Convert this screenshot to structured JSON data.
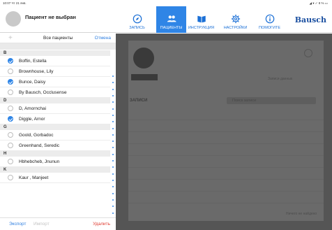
{
  "status_bar": {
    "time": "10:07  Чт 21 янв.",
    "system": "◢ ▾ ✓ 8 % ▭"
  },
  "header": {
    "patient_title": "Пациент не выбран",
    "brand": "Bausch",
    "nav": [
      {
        "label": "ЗАПИСЬ",
        "icon": "compass-icon",
        "active": false
      },
      {
        "label": "ПАЦИЕНТЫ",
        "icon": "people-icon",
        "active": true
      },
      {
        "label": "ИНСТРУКЦИЯ",
        "icon": "book-icon",
        "active": false
      },
      {
        "label": "НАСТРОЙКИ",
        "icon": "gear-icon",
        "active": false
      },
      {
        "label": "ПОМОГИТЕ",
        "icon": "info-icon",
        "active": false
      }
    ]
  },
  "patients_panel": {
    "add_glyph": "+",
    "title": "Все пациенты",
    "cancel_label": "Отмена",
    "sections": [
      {
        "letter": "B",
        "rows": [
          {
            "name": "Boffin, Estella",
            "checked": true
          },
          {
            "name": "Brownhouse, Lily",
            "checked": false
          },
          {
            "name": "Bunce, Daisy",
            "checked": true
          },
          {
            "name": "By Bausch, Occlusense",
            "checked": false
          }
        ]
      },
      {
        "letter": "D",
        "rows": [
          {
            "name": "D, Amornchai",
            "checked": false
          },
          {
            "name": "Diggle, Arnor",
            "checked": true
          }
        ]
      },
      {
        "letter": "G",
        "rows": [
          {
            "name": "Goold, Gorbadoc",
            "checked": false
          },
          {
            "name": "Greenhand, Seredic",
            "checked": false
          }
        ]
      },
      {
        "letter": "H",
        "rows": [
          {
            "name": "Hbhebcheb, Jnunun",
            "checked": false
          }
        ]
      },
      {
        "letter": "K",
        "rows": [
          {
            "name": "Kaur , Manjeet",
            "checked": false
          }
        ]
      }
    ],
    "footer": {
      "export_label": "Экспорт",
      "import_label": "Импорт",
      "delete_label": "Удалить"
    }
  },
  "background": {
    "edit_label": "Записи данных",
    "records_label": "ЗАПИСИ",
    "search_placeholder": "Поиск записи",
    "footer_text": "Ничего не найдено"
  },
  "colors": {
    "accent": "#2f85e6",
    "danger": "#e03c31",
    "overlay": "#555555"
  }
}
